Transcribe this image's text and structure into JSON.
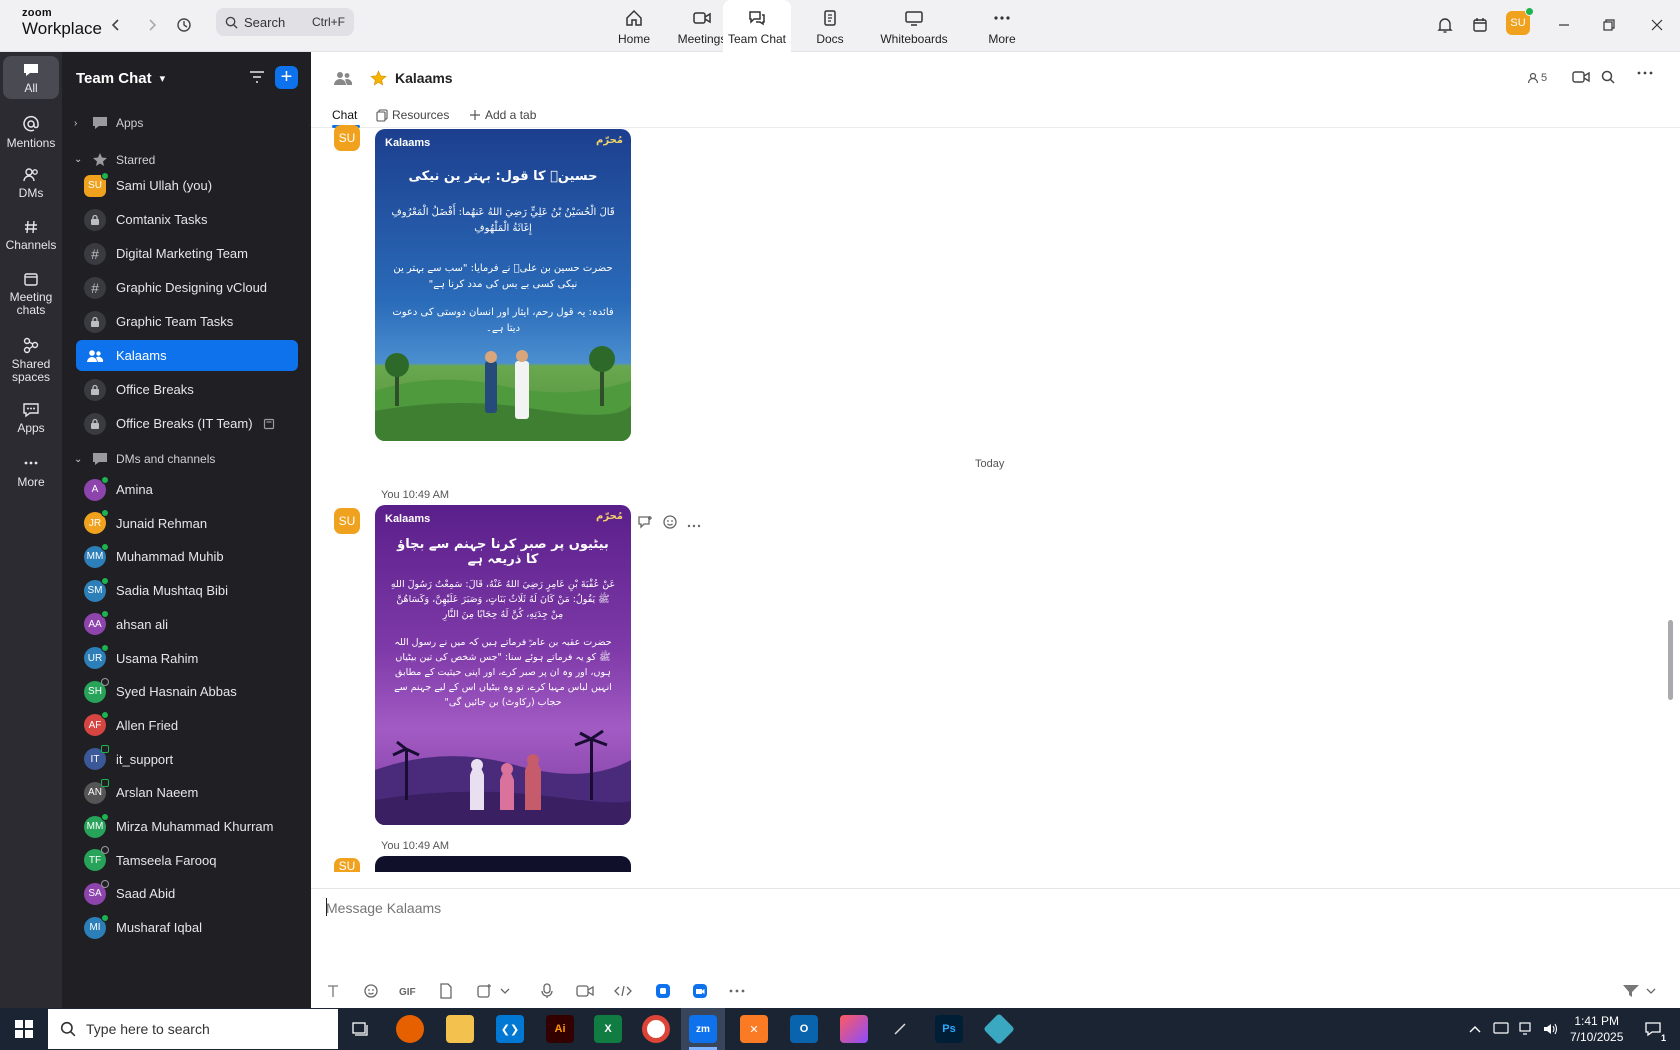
{
  "app": {
    "logo_line1": "zoom",
    "logo_line2": "Workplace"
  },
  "search": {
    "label": "Search",
    "shortcut": "Ctrl+F"
  },
  "top_tabs": [
    {
      "label": "Home",
      "icon": "home-icon"
    },
    {
      "label": "Meetings",
      "icon": "video-icon"
    },
    {
      "label": "Team Chat",
      "icon": "chat-icon"
    },
    {
      "label": "Docs",
      "icon": "doc-icon"
    },
    {
      "label": "Whiteboards",
      "icon": "whiteboard-icon"
    },
    {
      "label": "More",
      "icon": "more-icon"
    }
  ],
  "user": {
    "initials": "SU"
  },
  "rail": [
    {
      "label": "All"
    },
    {
      "label": "Mentions"
    },
    {
      "label": "DMs"
    },
    {
      "label": "Channels"
    },
    {
      "label": "Meeting chats"
    },
    {
      "label": "Shared spaces"
    },
    {
      "label": "Apps"
    },
    {
      "label": "More"
    }
  ],
  "sidebar": {
    "title": "Team Chat",
    "sections": {
      "apps": "Apps",
      "starred": "Starred",
      "dms": "DMs and channels"
    },
    "starred": [
      {
        "label": "Sami Ullah (you)",
        "initials": "SU",
        "color": "#f0a21e",
        "kind": "avatar-sq"
      },
      {
        "label": "Comtanix Tasks",
        "kind": "lock"
      },
      {
        "label": "Digital Marketing Team",
        "kind": "hash"
      },
      {
        "label": "Graphic Designing vCloud",
        "kind": "hash"
      },
      {
        "label": "Graphic Team Tasks",
        "kind": "lock"
      },
      {
        "label": "Kalaams",
        "kind": "group",
        "active": true
      },
      {
        "label": "Office Breaks",
        "kind": "lock"
      },
      {
        "label": "Office Breaks (IT Team)",
        "kind": "lock"
      }
    ],
    "dms": [
      {
        "label": "Amina",
        "initials": "A",
        "color": "#8e44ad",
        "status": "on"
      },
      {
        "label": "Junaid Rehman",
        "initials": "JR",
        "color": "#f0a21e",
        "status": "on"
      },
      {
        "label": "Muhammad Muhib",
        "initials": "MM",
        "color": "#2c7fb8",
        "status": "on"
      },
      {
        "label": "Sadia Mushtaq Bibi",
        "initials": "SM",
        "color": "#2c7fb8",
        "status": "on"
      },
      {
        "label": "ahsan ali",
        "initials": "AA",
        "color": "#8e44ad",
        "status": "on"
      },
      {
        "label": "Usama Rahim",
        "initials": "UR",
        "color": "#2c7fb8",
        "status": "on"
      },
      {
        "label": "Syed Hasnain Abbas",
        "initials": "SH",
        "color": "#27a35a",
        "status": "off"
      },
      {
        "label": "Allen Fried",
        "initials": "AF",
        "color": "#d64541",
        "status": "on"
      },
      {
        "label": "it_support",
        "initials": "IT",
        "color": "#3b5998",
        "status": "grn-off"
      },
      {
        "label": "Arslan Naeem",
        "initials": "AN",
        "color": "#555",
        "status": "grn-off"
      },
      {
        "label": "Mirza Muhammad Khurram",
        "initials": "MM",
        "color": "#27a35a",
        "status": "on"
      },
      {
        "label": "Tamseela Farooq",
        "initials": "TF",
        "color": "#27a35a",
        "status": "off"
      },
      {
        "label": "Saad Abid",
        "initials": "SA",
        "color": "#8e44ad",
        "status": "off"
      },
      {
        "label": "Musharaf Iqbal",
        "initials": "MI",
        "color": "#2c7fb8",
        "status": "on"
      }
    ]
  },
  "channel": {
    "name": "Kalaams",
    "member_count": "5",
    "tabs": {
      "chat": "Chat",
      "resources": "Resources",
      "add": "Add a tab"
    }
  },
  "messages": {
    "today": "Today",
    "meta1": "You 10:49 AM",
    "meta2": "You 10:49 AM",
    "card_brand": "Kalaams",
    "card_month": "مُحرّم",
    "card1": {
      "heading": "حسینؓ کا قول: بہتر ین نیکی",
      "arabic": "قَالَ الْحُسَيْنُ بْنُ عَلِيٍّ رَضِيَ اللهُ عَنهُما: أَفْضَلُ الْمَعْرُوفِ إِغَاثَةُ الْمَلْهُوفِ",
      "urdu": "حضرت حسین بن علیؓ نے فرمایا: \"سب سے بہتر ین نیکی کسی بے بس کی مدد کرنا ہے\"",
      "note": "فائدہ: یہ قول رحم، ایثار اور انسان دوستی کی دعوت دیتا ہے۔"
    },
    "card2": {
      "heading": "بیٹیوں پر صبر کرنا جہنم سے بچاؤ کا ذریعہ ہے",
      "arabic": "عَنْ عُقْبَةَ بْنِ عَامِرٍ رَضِيَ اللهُ عَنْهُ، قَالَ: سَمِعْتُ رَسُولَ اللهِ ﷺ يَقُولُ: مَنْ كَانَ لَهُ ثَلَاثُ بَنَاتٍ، وَصَبَرَ عَلَيْهِنَّ، وَكَسَاهُنَّ مِنْ جِدَتِهِ، كُنَّ لَهُ حِجَابًا مِنَ النَّارِ",
      "urdu": "حضرت عقبہ بن عامرؓ فرماتے ہیں کہ میں نے رسول اللہ ﷺ کو یہ فرماتے ہوئے سنا: \"جس شخص کی تین بیٹیاں ہوں، اور وہ ان پر صبر کرے، اور اپنی حیثیت کے مطابق انہیں لباس مہیا کرے، تو وہ بیٹیاں اس کے لیے جہنم سے حجاب (رکاوٹ) بن جائیں گی\""
    }
  },
  "composer": {
    "placeholder": "Message Kalaams"
  },
  "taskbar": {
    "search": "Type here to search",
    "time": "1:41 PM",
    "date": "7/10/2025",
    "notif": "1"
  }
}
